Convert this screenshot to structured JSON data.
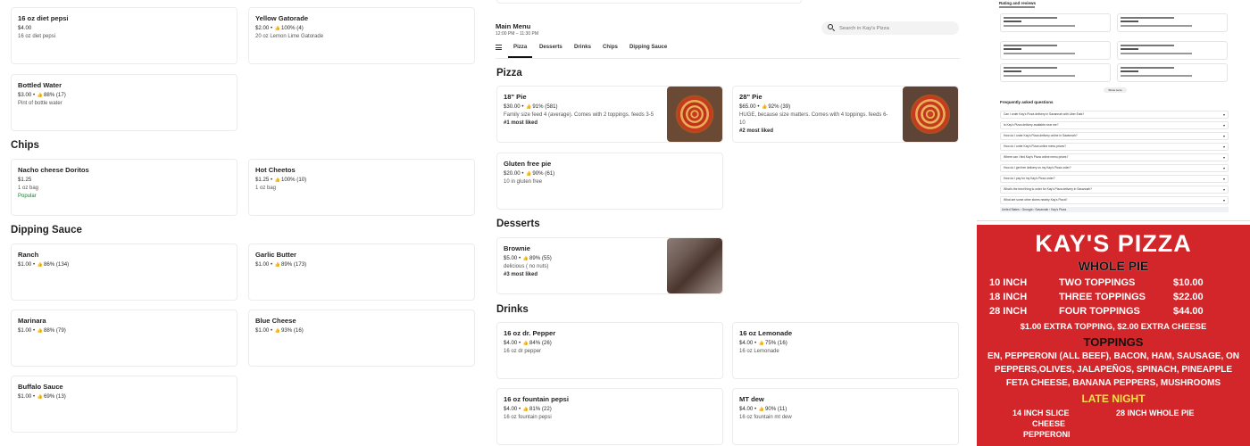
{
  "header": {
    "menu_title": "Main Menu",
    "hours": "12:00 PM – 11:30 PM",
    "search_placeholder": "Search in Kay's Pizza",
    "tabs": [
      "Pizza",
      "Desserts",
      "Drinks",
      "Chips",
      "Dipping Sauce"
    ],
    "active_tab": "Pizza"
  },
  "left_items": {
    "diet_pepsi": {
      "name": "16 oz diet pepsi",
      "meta": "$4.00",
      "desc": "16 oz diet pepsi"
    },
    "yellow_gatorade": {
      "name": "Yellow Gatorade",
      "price": "$2.00",
      "pct": "100% (4)",
      "desc": "20 oz Lemon Lime Gatorade"
    },
    "bottled_water": {
      "name": "Bottled Water",
      "price": "$3.00",
      "pct": "88% (17)",
      "desc": "Pint of bottle water"
    }
  },
  "chips": {
    "title": "Chips",
    "items": [
      {
        "name": "Nacho cheese Doritos",
        "price": "$1.25",
        "desc": "1 oz bag",
        "tag": "Popular"
      },
      {
        "name": "Hot Cheetos",
        "price": "$1.25",
        "pct": "100% (10)",
        "desc": "1 oz bag"
      }
    ]
  },
  "dipping": {
    "title": "Dipping Sauce",
    "items": [
      {
        "name": "Ranch",
        "price": "$1.00",
        "pct": "86% (134)"
      },
      {
        "name": "Garlic Butter",
        "price": "$1.00",
        "pct": "89% (173)"
      },
      {
        "name": "Marinara",
        "price": "$1.00",
        "pct": "88% (79)"
      },
      {
        "name": "Blue Cheese",
        "price": "$1.00",
        "pct": "93% (16)"
      },
      {
        "name": "Buffalo Sauce",
        "price": "$1.00",
        "pct": "69% (13)"
      }
    ]
  },
  "pizza": {
    "title": "Pizza",
    "items": [
      {
        "name": "18\" Pie",
        "price": "$30.00",
        "pct": "91% (581)",
        "desc1": "Family size feed 4 (average). Comes with 2 toppings. feeds 3-5",
        "fav": "#1 most liked"
      },
      {
        "name": "28\" Pie",
        "price": "$65.00",
        "pct": "92% (39)",
        "desc1": "HUGE, because size matters. Comes with 4 toppings. feeds 6-",
        "desc2": "10",
        "fav": "#2 most liked"
      },
      {
        "name": "Gluten free pie",
        "price": "$20.00",
        "pct": "90% (61)",
        "desc1": "10 in gluten free"
      }
    ]
  },
  "desserts": {
    "title": "Desserts",
    "items": [
      {
        "name": "Brownie",
        "price": "$5.00",
        "pct": "89% (55)",
        "desc": "delicious ( no nuts)",
        "fav": "#3 most liked"
      }
    ]
  },
  "drinks": {
    "title": "Drinks",
    "items": [
      {
        "name": "16 oz dr. Pepper",
        "price": "$4.00",
        "pct": "84% (26)",
        "desc": "16 oz dr pepper"
      },
      {
        "name": "16 oz Lemonade",
        "price": "$4.00",
        "pct": "75% (16)",
        "desc": "16 oz Lemonade"
      },
      {
        "name": "16 oz fountain pepsi",
        "price": "$4.00",
        "pct": "81% (22)",
        "desc": "16 oz fountain pepsi"
      },
      {
        "name": "MT dew",
        "price": "$4.00",
        "pct": "90% (11)",
        "desc": "16 oz fountain mt dew"
      }
    ]
  },
  "sidebar": {
    "reviews_title": "Rating and reviews",
    "faq_title": "Frequently asked questions",
    "show_more": "Show more",
    "faqs": [
      "Can I order Kay's Pizza delivery in Savannah with Uber Eats?",
      "Is Kay's Pizza delivery available near me?",
      "How do I order Kay's Pizza delivery online in Savannah?",
      "How do I order Kay's Pizza online menu prices?",
      "Where can I find Kay's Pizza online menu prices?",
      "How do I get free delivery on my Kay's Pizza order?",
      "How do I pay for my Kay's Pizza order?",
      "What's the best thing to order for Kay's Pizza delivery in Savannah?",
      "What are some other stores nearby Kay's Pizza?"
    ],
    "breadcrumb": [
      "United States",
      "Georgia",
      "Savannah",
      "Kay's Pizza"
    ]
  },
  "poster": {
    "title": "KAY'S PIZZA",
    "subtitle": "WHOLE PIE",
    "rows": [
      [
        "10 INCH",
        "TWO TOPPINGS",
        "$10.00"
      ],
      [
        "18 INCH",
        "THREE TOPPINGS",
        "$22.00"
      ],
      [
        "28 INCH",
        "FOUR TOPPINGS",
        "$44.00"
      ]
    ],
    "extra": "$1.00 EXTRA TOPPING, $2.00 EXTRA CHEESE",
    "toppings_title": "TOPPINGS",
    "toppings": [
      "EN, PEPPERONI (ALL BEEF), BACON, HAM, SAUSAGE, ON",
      "PEPPERS,OLIVES, JALAPEÑOS, SPINACH, PINEAPPLE",
      "FETA CHEESE, BANANA PEPPERS, MUSHROOMS"
    ],
    "late": "LATE NIGHT",
    "slice": "14 INCH SLICE",
    "slice2": "CHEESE",
    "slice3": "PEPPERONI",
    "whole": "28 INCH WHOLE PIE"
  }
}
